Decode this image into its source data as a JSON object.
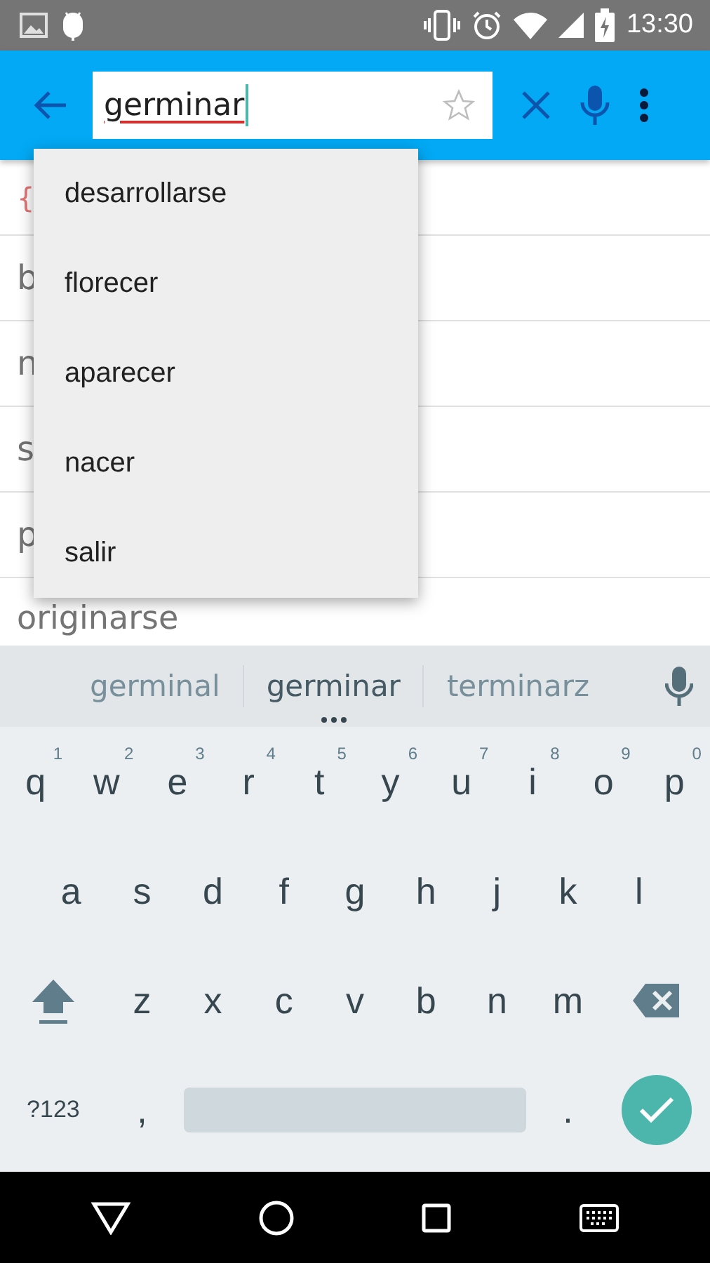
{
  "status_bar": {
    "time": "13:30"
  },
  "toolbar": {
    "query": "germinar",
    "misspelled": true,
    "bookmarked": false
  },
  "results": [
    {
      "text": "{",
      "kind": "tag"
    },
    {
      "text": "b",
      "kind": "word"
    },
    {
      "text": "n",
      "kind": "word"
    },
    {
      "text": "s",
      "kind": "word"
    },
    {
      "text": "p",
      "kind": "word"
    },
    {
      "text": "originarse",
      "kind": "word"
    }
  ],
  "dropdown": [
    "desarrollarse",
    "florecer",
    "aparecer",
    "nacer",
    "salir"
  ],
  "keyboard": {
    "suggestions": [
      {
        "text": "germinal",
        "selected": false
      },
      {
        "text": "germinar",
        "selected": true
      },
      {
        "text": "terminarz",
        "selected": false
      }
    ],
    "rows": [
      [
        {
          "label": "q",
          "hint": "1",
          "kind": "letter"
        },
        {
          "label": "w",
          "hint": "2",
          "kind": "letter"
        },
        {
          "label": "e",
          "hint": "3",
          "kind": "letter"
        },
        {
          "label": "r",
          "hint": "4",
          "kind": "letter"
        },
        {
          "label": "t",
          "hint": "5",
          "kind": "letter"
        },
        {
          "label": "y",
          "hint": "6",
          "kind": "letter"
        },
        {
          "label": "u",
          "hint": "7",
          "kind": "letter"
        },
        {
          "label": "i",
          "hint": "8",
          "kind": "letter"
        },
        {
          "label": "o",
          "hint": "9",
          "kind": "letter"
        },
        {
          "label": "p",
          "hint": "0",
          "kind": "letter"
        }
      ],
      [
        {
          "label": "a",
          "kind": "letter"
        },
        {
          "label": "s",
          "kind": "letter"
        },
        {
          "label": "d",
          "kind": "letter"
        },
        {
          "label": "f",
          "kind": "letter"
        },
        {
          "label": "g",
          "kind": "letter"
        },
        {
          "label": "h",
          "kind": "letter"
        },
        {
          "label": "j",
          "kind": "letter"
        },
        {
          "label": "k",
          "kind": "letter"
        },
        {
          "label": "l",
          "kind": "letter"
        }
      ],
      [
        {
          "kind": "shift"
        },
        {
          "label": "z",
          "kind": "letter"
        },
        {
          "label": "x",
          "kind": "letter"
        },
        {
          "label": "c",
          "kind": "letter"
        },
        {
          "label": "v",
          "kind": "letter"
        },
        {
          "label": "b",
          "kind": "letter"
        },
        {
          "label": "n",
          "kind": "letter"
        },
        {
          "label": "m",
          "kind": "letter"
        },
        {
          "kind": "backspace"
        }
      ]
    ],
    "bottom_row": [
      {
        "label": "?123",
        "kind": "symbols"
      },
      {
        "label": ",",
        "kind": "letter"
      },
      {
        "kind": "space"
      },
      {
        "label": ".",
        "kind": "letter"
      },
      {
        "kind": "enter"
      }
    ]
  }
}
